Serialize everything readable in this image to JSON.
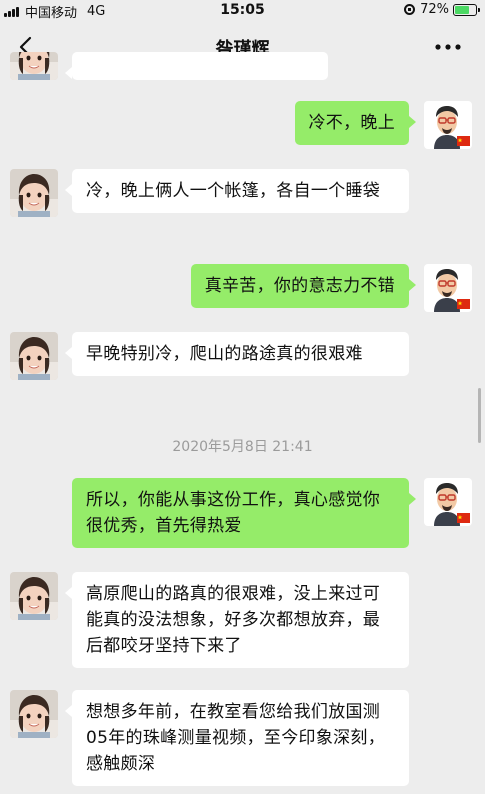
{
  "status_bar": {
    "carrier": "中国移动",
    "network": "4G",
    "time": "15:05",
    "battery": "72%",
    "battery_level": 0.72
  },
  "nav": {
    "title": "昝瑾辉",
    "back_icon": "chevron-left-icon",
    "more_icon": "ellipsis-icon"
  },
  "messages": [
    {
      "from": "me",
      "text": "冷不，晚上"
    },
    {
      "from": "contact",
      "text": "冷，晚上俩人一个帐篷，各自一个睡袋"
    },
    {
      "from": "me",
      "text": "真辛苦，你的意志力不错"
    },
    {
      "from": "contact",
      "text": "早晚特别冷，爬山的路途真的很艰难"
    },
    {
      "from": "me",
      "text": "所以，你能从事这份工作，真心感觉你很优秀，首先得热爱"
    },
    {
      "from": "contact",
      "text": "高原爬山的路真的很艰难，没上来过可能真的没法想象，好多次都想放弃，最后都咬牙坚持下来了"
    },
    {
      "from": "contact",
      "text": "想想多年前，在教室看您给我们放国测05年的珠峰测量视频，至今印象深刻，感触颇深"
    }
  ],
  "timestamp": "2020年5月8日 21:41",
  "colors": {
    "background": "#ededed",
    "outgoing_bubble": "#95ec69",
    "incoming_bubble": "#ffffff",
    "timestamp_text": "#9b9b9b"
  }
}
